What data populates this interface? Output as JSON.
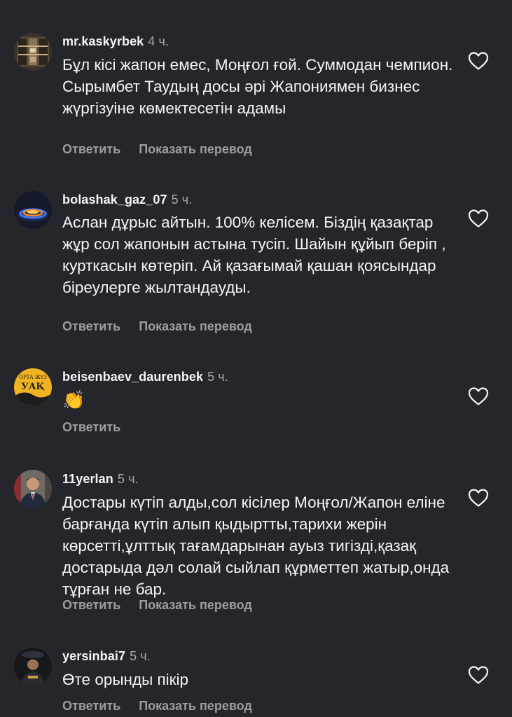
{
  "comments": [
    {
      "username": "mr.kaskyrbek",
      "time": "4 ч.",
      "text": "Бұл кісі жапон емес, Моңғол ғой. Суммодан чемпион. Сырымбет Таудың досы әрі Жапониямен бизнес жүргізуіне көмектесетін адамы",
      "reply": "Ответить",
      "translate": "Показать перевод",
      "avatar_icon": "bookshelf-photo"
    },
    {
      "username": "bolashak_gaz_07",
      "time": "5 ч.",
      "text": "Аслан дұрыс айтын. 100% келісем. Біздің қазақтар жұр сол жапонын астына тусіп. Шайын құйып беріп , курткасын көтеріп. Ай қазағымай қашан қоясындар біреулерге жылтандауды.",
      "reply": "Ответить",
      "translate": "Показать перевод",
      "avatar_icon": "gas-flame-photo"
    },
    {
      "username": "beisenbaev_daurenbek",
      "time": "5 ч.",
      "text": "👏",
      "reply": "Ответить",
      "avatar_icon": "logo-badge",
      "avatar_text_top": "ОРТА ЖҮЗ",
      "avatar_text_main": "УАҚ"
    },
    {
      "username": "11yerlan",
      "time": "5 ч.",
      "text": "Достары күтіп алды,сол кісілер Моңғол/Жапон еліне барғанда күтіп алып қыдыртты,тарихи жерін көрсетті,ұлттық тағамдарынан ауыз тигізді,қазақ достарыда дәл солай сыйлап құрметтеп жатыр,онда тұрған не бар.",
      "reply": "Ответить",
      "translate": "Показать перевод",
      "avatar_icon": "man-in-suit-photo"
    },
    {
      "username": "yersinbai7",
      "time": "5 ч.",
      "text": "Өте орынды пікір",
      "reply": "Ответить",
      "translate": "Показать перевод",
      "avatar_icon": "person-dark-photo"
    }
  ],
  "colors": {
    "background": "#25262b",
    "text": "#f5f5f5",
    "secondary": "#9c9ca1"
  }
}
